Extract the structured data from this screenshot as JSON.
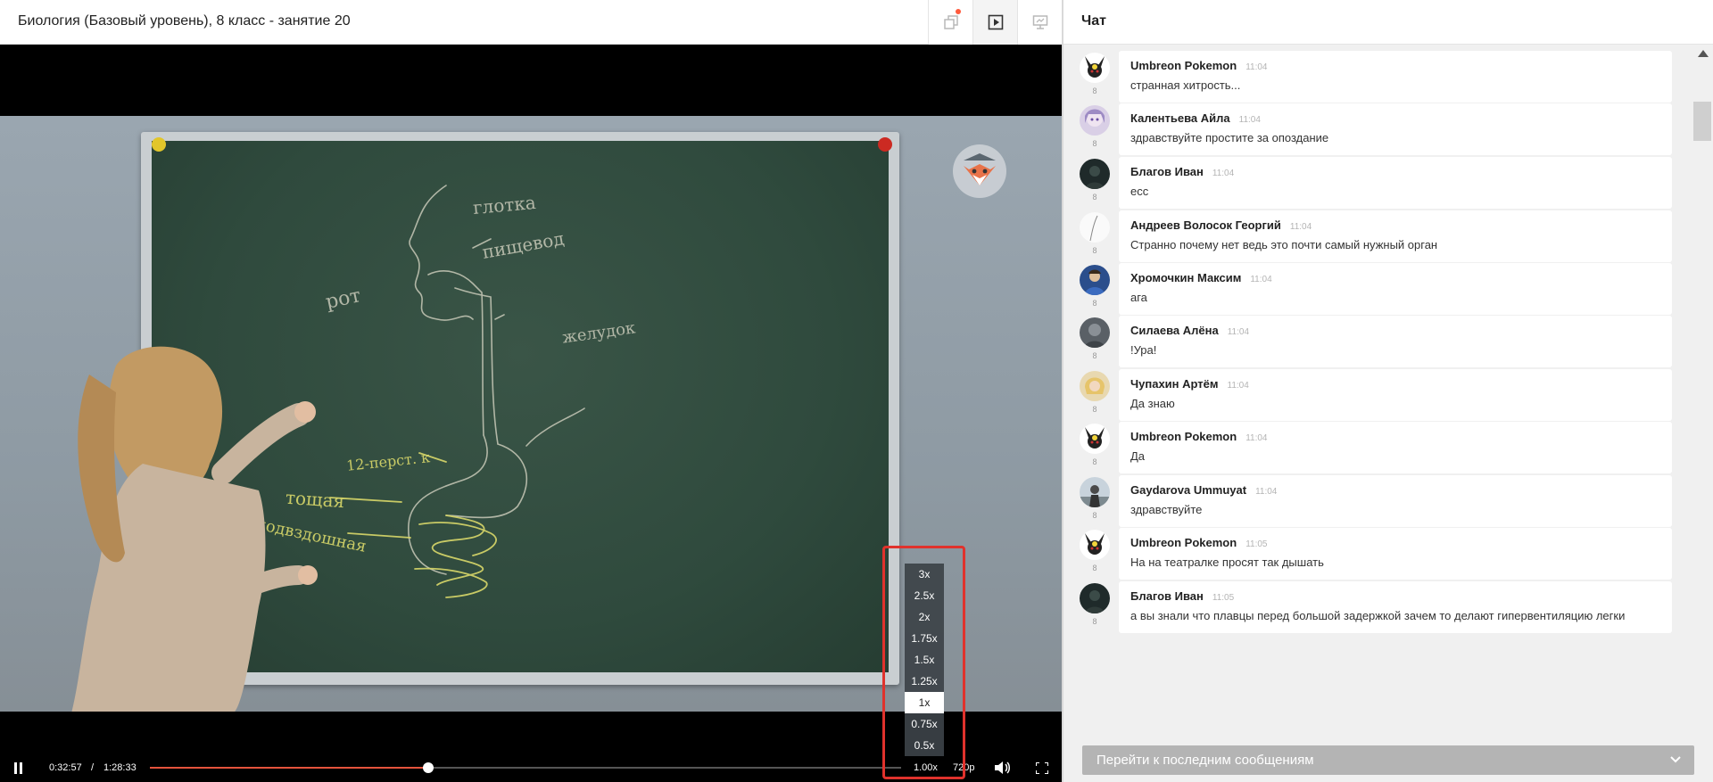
{
  "lesson": {
    "title": "Биология (Базовый уровень), 8 класс - занятие 20",
    "header_buttons": [
      {
        "icon": "copy-window-icon"
      },
      {
        "icon": "video-play-icon"
      },
      {
        "icon": "presentation-icon"
      }
    ]
  },
  "player": {
    "current_time": "0:32:57",
    "separator": "/",
    "duration": "1:28:33",
    "progress": 0.371,
    "speed_label": "1.00x",
    "quality_label": "720p",
    "speed_options": [
      "3x",
      "2.5x",
      "2x",
      "1.75x",
      "1.5x",
      "1.25x",
      "1x",
      "0.75x",
      "0.5x"
    ],
    "selected_speed": "1x",
    "board_words": [
      "рот",
      "глотка",
      "пищевод",
      "желудок",
      "12-перст. к",
      "тощая",
      "подвздошная"
    ]
  },
  "chat": {
    "title": "Чат",
    "messages": [
      {
        "name": "Umbreon Pokemon",
        "time": "11:04",
        "text": "странная хитрость...",
        "level": "8",
        "avatar": "umbreon"
      },
      {
        "name": "Калентьева Айла",
        "time": "11:04",
        "text": "здравствуйте простите за опоздание",
        "level": "8",
        "avatar": "anime"
      },
      {
        "name": "Благов Иван",
        "time": "11:04",
        "text": "есс",
        "level": "8",
        "avatar": "dark"
      },
      {
        "name": "Андреев Волосок Георгий",
        "time": "11:04",
        "text": "Странно почему нет ведь это почти самый нужный орган",
        "level": "8",
        "avatar": "hair"
      },
      {
        "name": "Хромочкин Максим",
        "time": "11:04",
        "text": "ага",
        "level": "8",
        "avatar": "blue"
      },
      {
        "name": "Силаева Алёна",
        "time": "11:04",
        "text": "!Ура!",
        "level": "8",
        "avatar": "gray"
      },
      {
        "name": "Чупахин Артём",
        "time": "11:04",
        "text": "Да знаю",
        "level": "8",
        "avatar": "blond"
      },
      {
        "name": "Umbreon Pokemon",
        "time": "11:04",
        "text": "Да",
        "level": "8",
        "avatar": "umbreon"
      },
      {
        "name": "Gaydarova Ummuyat",
        "time": "11:04",
        "text": "здравствуйте",
        "level": "8",
        "avatar": "photo"
      },
      {
        "name": "Umbreon Pokemon",
        "time": "11:05",
        "text": "На на театралке просят так дышать",
        "level": "8",
        "avatar": "umbreon"
      },
      {
        "name": "Благов Иван",
        "time": "11:05",
        "text": "а вы знали что плавцы перед большой задержкой зачем то делают гипервентиляцию легки",
        "level": "8",
        "avatar": "dark"
      }
    ],
    "goto_latest_label": "Перейти к последним сообщениям"
  },
  "colors": {
    "accent_progress": "#e5533c",
    "highlight_border": "#e0322c",
    "notification_dot": "#ff5a3c"
  }
}
